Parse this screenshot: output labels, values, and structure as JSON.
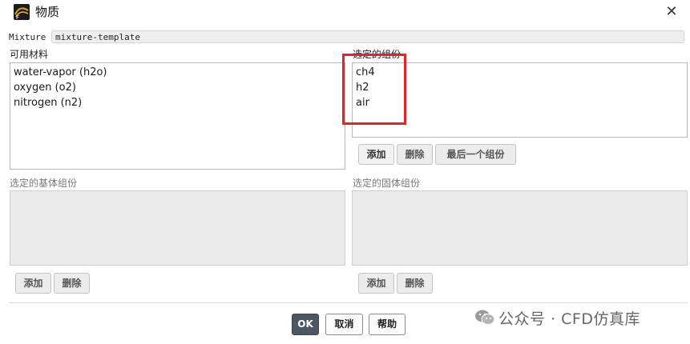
{
  "window": {
    "title": "物质",
    "icon": "fluent-app-icon",
    "close_icon": "close-icon"
  },
  "mixture": {
    "label": "Mixture",
    "value": "mixture-template"
  },
  "available": {
    "label": "可用材料",
    "items": [
      "water-vapor (h2o)",
      "oxygen (o2)",
      "nitrogen (n2)"
    ]
  },
  "selected_species": {
    "label": "选定的组份",
    "items": [
      "ch4",
      "h2",
      "air"
    ],
    "buttons": {
      "add": "添加",
      "delete": "删除",
      "last": "最后一个组份"
    }
  },
  "bulk_species": {
    "label": "选定的基体组份",
    "buttons": {
      "add": "添加",
      "delete": "删除"
    }
  },
  "solid_species": {
    "label": "选定的固体组份",
    "buttons": {
      "add": "添加",
      "delete": "删除"
    }
  },
  "dialog_buttons": {
    "ok": "OK",
    "cancel": "取消",
    "help": "帮助"
  },
  "watermark": {
    "text": "公众号 · CFD仿真库",
    "icon": "wechat-icon"
  },
  "colors": {
    "highlight": "#e0242b",
    "primary_button": "#4d5663"
  }
}
